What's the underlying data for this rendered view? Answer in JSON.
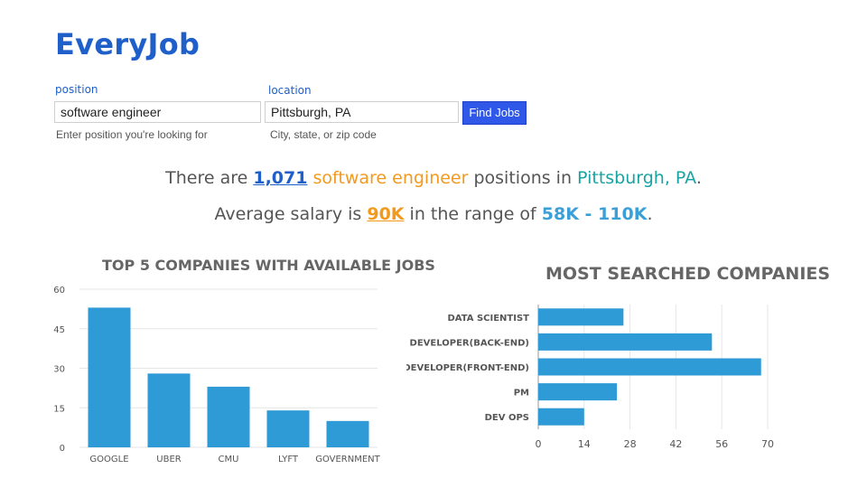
{
  "app": {
    "title": "EveryJob"
  },
  "search": {
    "position_label": "position",
    "position_value": "software engineer",
    "position_hint": "Enter position you're looking for",
    "location_label": "location",
    "location_value": "Pittsburgh, PA",
    "location_hint": "City, state, or zip code",
    "button_label": "Find Jobs"
  },
  "summary": {
    "line1_prefix": "There are ",
    "count": "1,071",
    "role": "software engineer",
    "line1_mid": " positions in ",
    "location": "Pittsburgh, PA",
    "line1_end": ".",
    "line2_prefix": "Average salary is ",
    "avg_salary": "90K",
    "line2_mid": " in the range of ",
    "range": "58K - 110K",
    "line2_end": "."
  },
  "colors": {
    "bar": "#2f9bd6",
    "brand": "#1f5fc9",
    "orange": "#f39a1e",
    "teal": "#19a3a3"
  },
  "chart_data": [
    {
      "type": "bar",
      "title": "TOP 5 COMPANIES WITH AVAILABLE JOBS",
      "categories": [
        "GOOGLE",
        "UBER",
        "CMU",
        "LYFT",
        "GOVERNMENT"
      ],
      "values": [
        53,
        28,
        23,
        14,
        10
      ],
      "yticks": [
        0,
        15,
        30,
        45,
        60
      ],
      "ylim": [
        0,
        60
      ],
      "grid": true
    },
    {
      "type": "bar",
      "orientation": "horizontal",
      "title": "MOST SEARCHED COMPANIES",
      "categories": [
        "DATA SCIENTIST",
        "DEVELOPER(BACK-END)",
        "DEVELOPER(FRONT-END)",
        "PM",
        "DEV OPS"
      ],
      "values": [
        26,
        53,
        68,
        24,
        14
      ],
      "xticks": [
        0,
        14,
        28,
        42,
        56,
        70
      ],
      "xlim": [
        0,
        70
      ],
      "grid": true
    }
  ]
}
